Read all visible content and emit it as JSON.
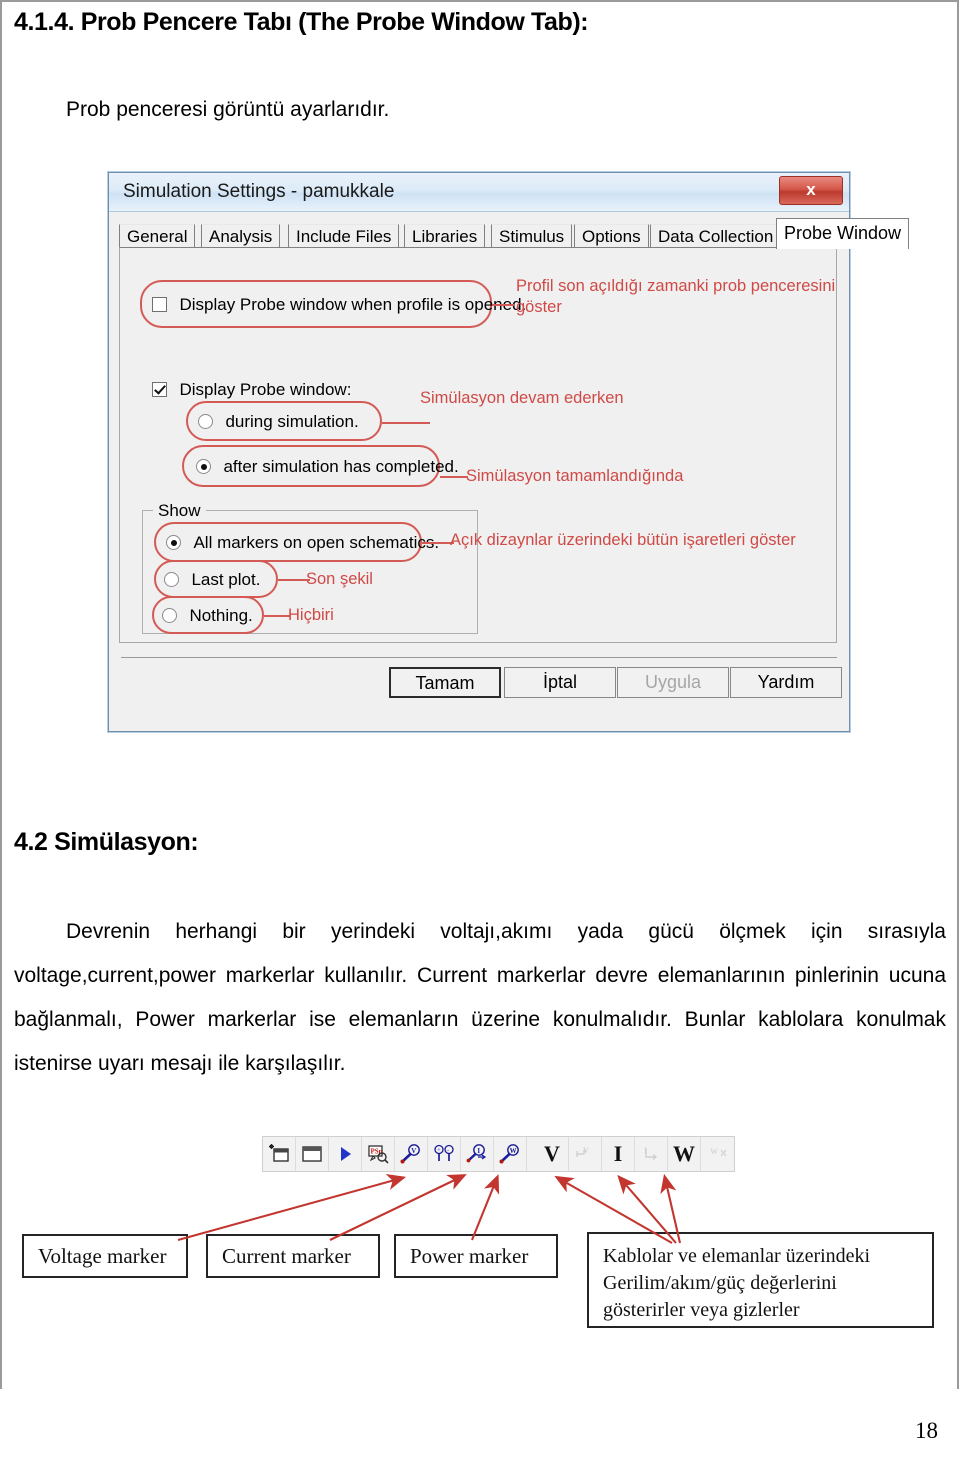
{
  "document": {
    "heading_414": "4.1.4. Prob Pencere Tabı (The Probe Window Tab):",
    "intro_paragraph": "Prob penceresi görüntü ayarlarıdır.",
    "heading_42": "4.2 Simülasyon:",
    "sim_paragraph": "Devrenin herhangi bir yerindeki voltajı,akımı yada gücü ölçmek için sırasıyla voltage,current,power markerlar kullanılır. Current markerlar devre elemanlarının pinlerinin ucuna bağlanmalı, Power markerlar ise elemanların üzerine konulmalıdır. Bunlar kablolara konulmak istenirse uyarı mesajı ile karşılaşılır.",
    "page_number": "18"
  },
  "dialog": {
    "title": "Simulation Settings - pamukkale",
    "close_label": "x",
    "tabs": [
      {
        "label": "General",
        "active": false
      },
      {
        "label": "Analysis",
        "active": false
      },
      {
        "label": "Include Files",
        "active": false
      },
      {
        "label": "Libraries",
        "active": false
      },
      {
        "label": "Stimulus",
        "active": false
      },
      {
        "label": "Options",
        "active": false
      },
      {
        "label": "Data Collection",
        "active": false
      },
      {
        "label": "Probe Window",
        "active": true
      }
    ],
    "checkbox_open_profile": {
      "label": "Display Probe window when profile is opened.",
      "checked": false,
      "annotation": "Profil son açıldığı zamanki prob penceresini\ngöster"
    },
    "checkbox_display_probe": {
      "label": "Display Probe window:",
      "checked": true
    },
    "radio_during": {
      "label": "during simulation.",
      "selected": false,
      "annotation": "Simülasyon devam ederken"
    },
    "radio_after": {
      "label": "after simulation has completed.",
      "selected": true,
      "annotation": "Simülasyon tamamlandığında"
    },
    "show_group": {
      "legend": "Show",
      "options": [
        {
          "label": "All markers on open schematics.",
          "selected": true,
          "annotation": "Açık dizaynlar üzerindeki bütün işaretleri göster"
        },
        {
          "label": "Last plot.",
          "selected": false,
          "annotation": "Son şekil"
        },
        {
          "label": "Nothing.",
          "selected": false,
          "annotation": "Hiçbiri"
        }
      ]
    },
    "buttons": [
      {
        "label": "Tamam",
        "state": "default"
      },
      {
        "label": "İptal",
        "state": "normal"
      },
      {
        "label": "Uygula",
        "state": "disabled"
      },
      {
        "label": "Yardım",
        "state": "normal"
      }
    ]
  },
  "toolbar": {
    "items": [
      {
        "name": "new-simulation-profile-icon",
        "glyph": ""
      },
      {
        "name": "edit-simulation-profile-icon",
        "glyph": ""
      },
      {
        "name": "run-simulation-icon",
        "glyph": ""
      },
      {
        "name": "view-simulation-results-icon",
        "glyph": ""
      },
      {
        "name": "voltage-level-marker-icon",
        "glyph": ""
      },
      {
        "name": "voltage-differential-marker-icon",
        "glyph": ""
      },
      {
        "name": "current-marker-icon",
        "glyph": ""
      },
      {
        "name": "power-marker-icon",
        "glyph": ""
      },
      {
        "name": "show-voltage-icon",
        "glyph": "V"
      },
      {
        "name": "show-voltage-differential-icon",
        "glyph": "V"
      },
      {
        "name": "show-current-icon",
        "glyph": "I"
      },
      {
        "name": "show-current-direction-icon",
        "glyph": "I"
      },
      {
        "name": "show-power-icon",
        "glyph": "W"
      },
      {
        "name": "hide-values-icon",
        "glyph": "W"
      }
    ]
  },
  "marker_labels": {
    "voltage": "Voltage marker",
    "current": "Current marker",
    "power": "Power marker",
    "values_box": "Kablolar ve elemanlar üzerindeki\nGerilim/akım/güç değerlerini\ngösterirler veya gizlerler"
  },
  "colors": {
    "annotation_red": "#cf4a46",
    "callout_red": "#d35a55",
    "arrow_red": "#c3352f",
    "close_button_red": "#bb3b2d",
    "title_blue": "#cfe2f4"
  }
}
